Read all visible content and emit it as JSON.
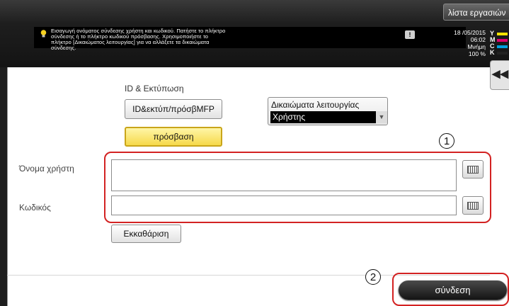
{
  "header": {
    "job_list_button": "λίστα εργασιών",
    "message_lines": [
      "Εισαγωγή ονόματος σύνδεσης χρήστη και κωδικού. Πατήστε το πλήκτρο",
      "σύνδεσης ή το πλήκτρο κωδικού πρόσβασης. Χρησιμοποιήστε το",
      "πλήκτρο [Δικαιώματος λειτουργίας] για να αλλάξετε τα δικαιώματα",
      "σύνδεσης."
    ],
    "alert_symbol": "!",
    "date": "18 /05/2015",
    "time": "06:02",
    "memory_label": "Μνήμη",
    "memory_value": "100 %",
    "toner": [
      {
        "letter": "Y",
        "color": "#f5e400"
      },
      {
        "letter": "M",
        "color": "#e0006e"
      },
      {
        "letter": "C",
        "color": "#00a0e0"
      },
      {
        "letter": "K",
        "color": "#222222"
      }
    ],
    "collapse_symbol": "◀◀"
  },
  "auth": {
    "section_label": "ID & Εκτύπωση",
    "id_print_button": "ID&εκτύπ/πρόσβMFP",
    "access_button": "πρόσβαση",
    "rights_label": "Δικαιώματα λειτουργίας",
    "rights_value": "Χρήστης",
    "dropdown_arrow": "▼"
  },
  "form": {
    "username_label": "Όνομα χρήστη",
    "username_value": "",
    "password_label": "Κωδικός",
    "password_value": "",
    "clear_button": "Εκκαθάριση"
  },
  "annotations": {
    "callout_1": "1",
    "callout_2": "2"
  },
  "footer": {
    "login_button": "σύνδεση"
  },
  "colors": {
    "selected_button": "#f6d94a",
    "callout_red": "#d32222"
  }
}
